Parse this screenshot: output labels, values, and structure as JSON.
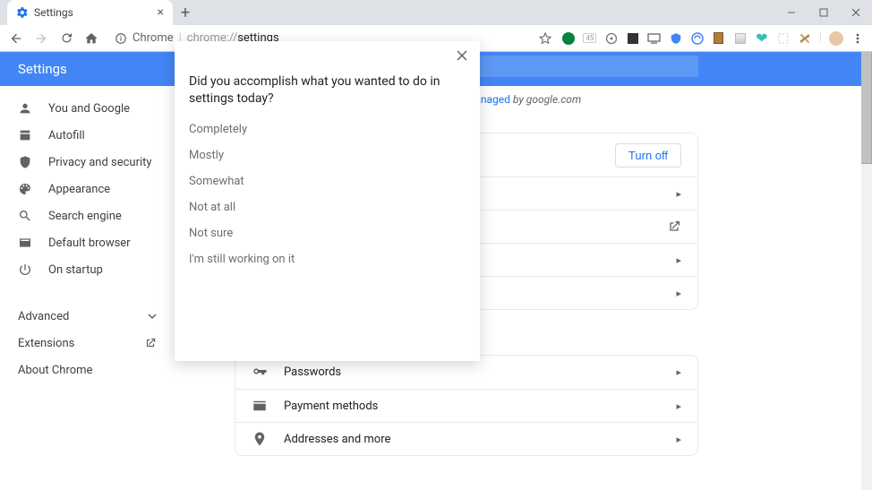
{
  "tab": {
    "title": "Settings"
  },
  "omnibox": {
    "chrome_label": "Chrome",
    "scheme": "chrome://",
    "path": "settings"
  },
  "header": {
    "title": "Settings"
  },
  "managed_notice": {
    "suffix": " by google.com",
    "link": "managed"
  },
  "sidebar": {
    "items": [
      {
        "label": "You and Google"
      },
      {
        "label": "Autofill"
      },
      {
        "label": "Privacy and security"
      },
      {
        "label": "Appearance"
      },
      {
        "label": "Search engine"
      },
      {
        "label": "Default browser"
      },
      {
        "label": "On startup"
      }
    ],
    "advanced": "Advanced",
    "extensions": "Extensions",
    "about": "About Chrome"
  },
  "sync_card": {
    "turn_off": "Turn off",
    "rows": [
      {
        "label": ""
      },
      {
        "label": ""
      },
      {
        "label": ""
      },
      {
        "label": ""
      },
      {
        "label": ""
      }
    ]
  },
  "autofill_card": {
    "passwords": "Passwords",
    "payment": "Payment methods",
    "addresses": "Addresses and more"
  },
  "survey": {
    "question": "Did you accomplish what you wanted to do in settings today?",
    "options": [
      "Completely",
      "Mostly",
      "Somewhat",
      "Not at all",
      "Not sure",
      "I'm still working on it"
    ]
  }
}
